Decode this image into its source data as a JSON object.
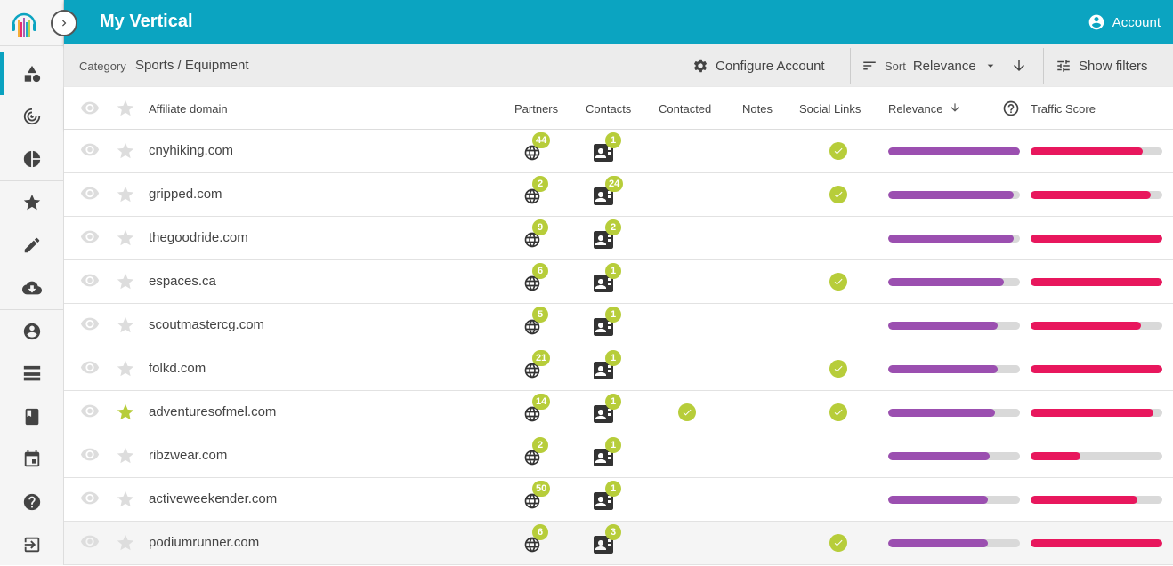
{
  "app": {
    "title": "My Vertical",
    "account_label": "Account"
  },
  "subbar": {
    "category_label": "Category",
    "category_value": "Sports / Equipment",
    "configure_label": "Configure Account",
    "sort_label": "Sort",
    "sort_value": "Relevance",
    "filters_label": "Show filters"
  },
  "sidebar": {
    "items": [
      "dashboard-shapes-icon",
      "target-icon",
      "pie-chart-icon",
      "star-icon",
      "edit-icon",
      "cloud-download-icon",
      "account-circle-icon",
      "list-icon",
      "book-icon",
      "calendar-icon",
      "help-icon",
      "logout-icon"
    ]
  },
  "columns": {
    "domain": "Affiliate domain",
    "partners": "Partners",
    "contacts": "Contacts",
    "contacted": "Contacted",
    "notes": "Notes",
    "social": "Social Links",
    "relevance": "Relevance",
    "traffic": "Traffic Score"
  },
  "colors": {
    "accent": "#0ba4c1",
    "badge": "#b7cd3a",
    "relevance": "#9b4fb0",
    "traffic": "#e8175d"
  },
  "rows": [
    {
      "domain": "cnyhiking.com",
      "partners": "44",
      "contacts": "1",
      "contacted": false,
      "social": true,
      "starred": false,
      "relevance": 1.0,
      "traffic": 0.85
    },
    {
      "domain": "gripped.com",
      "partners": "2",
      "contacts": "24",
      "contacted": false,
      "social": true,
      "starred": false,
      "relevance": 0.95,
      "traffic": 0.91
    },
    {
      "domain": "thegoodride.com",
      "partners": "9",
      "contacts": "2",
      "contacted": false,
      "social": false,
      "starred": false,
      "relevance": 0.95,
      "traffic": 1.0
    },
    {
      "domain": "espaces.ca",
      "partners": "6",
      "contacts": "1",
      "contacted": false,
      "social": true,
      "starred": false,
      "relevance": 0.88,
      "traffic": 1.0
    },
    {
      "domain": "scoutmastercg.com",
      "partners": "5",
      "contacts": "1",
      "contacted": false,
      "social": false,
      "starred": false,
      "relevance": 0.83,
      "traffic": 0.84
    },
    {
      "domain": "folkd.com",
      "partners": "21",
      "contacts": "1",
      "contacted": false,
      "social": true,
      "starred": false,
      "relevance": 0.83,
      "traffic": 1.0
    },
    {
      "domain": "adventuresofmel.com",
      "partners": "14",
      "contacts": "1",
      "contacted": true,
      "social": true,
      "starred": true,
      "relevance": 0.81,
      "traffic": 0.93
    },
    {
      "domain": "ribzwear.com",
      "partners": "2",
      "contacts": "1",
      "contacted": false,
      "social": false,
      "starred": false,
      "relevance": 0.77,
      "traffic": 0.38
    },
    {
      "domain": "activeweekender.com",
      "partners": "50",
      "contacts": "1",
      "contacted": false,
      "social": false,
      "starred": false,
      "relevance": 0.76,
      "traffic": 0.81
    },
    {
      "domain": "podiumrunner.com",
      "partners": "6",
      "contacts": "3",
      "contacted": false,
      "social": true,
      "starred": false,
      "relevance": 0.76,
      "traffic": 1.0
    }
  ]
}
